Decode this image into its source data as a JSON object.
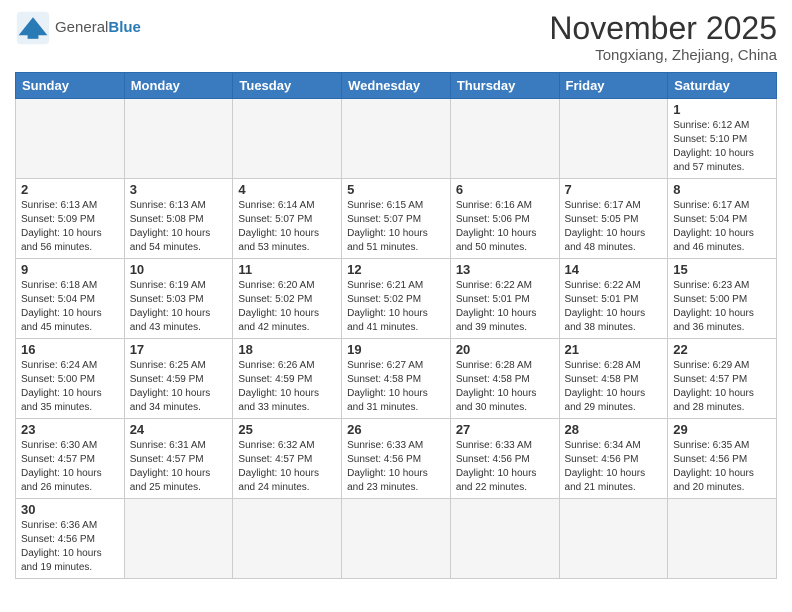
{
  "header": {
    "logo_general": "General",
    "logo_blue": "Blue",
    "month_title": "November 2025",
    "subtitle": "Tongxiang, Zhejiang, China"
  },
  "weekdays": [
    "Sunday",
    "Monday",
    "Tuesday",
    "Wednesday",
    "Thursday",
    "Friday",
    "Saturday"
  ],
  "weeks": [
    [
      {
        "day": "",
        "empty": true
      },
      {
        "day": "",
        "empty": true
      },
      {
        "day": "",
        "empty": true
      },
      {
        "day": "",
        "empty": true
      },
      {
        "day": "",
        "empty": true
      },
      {
        "day": "",
        "empty": true
      },
      {
        "day": "1",
        "sunrise": "Sunrise: 6:12 AM",
        "sunset": "Sunset: 5:10 PM",
        "daylight": "Daylight: 10 hours and 57 minutes."
      }
    ],
    [
      {
        "day": "2",
        "sunrise": "Sunrise: 6:13 AM",
        "sunset": "Sunset: 5:09 PM",
        "daylight": "Daylight: 10 hours and 56 minutes."
      },
      {
        "day": "3",
        "sunrise": "Sunrise: 6:13 AM",
        "sunset": "Sunset: 5:08 PM",
        "daylight": "Daylight: 10 hours and 54 minutes."
      },
      {
        "day": "4",
        "sunrise": "Sunrise: 6:14 AM",
        "sunset": "Sunset: 5:07 PM",
        "daylight": "Daylight: 10 hours and 53 minutes."
      },
      {
        "day": "5",
        "sunrise": "Sunrise: 6:15 AM",
        "sunset": "Sunset: 5:07 PM",
        "daylight": "Daylight: 10 hours and 51 minutes."
      },
      {
        "day": "6",
        "sunrise": "Sunrise: 6:16 AM",
        "sunset": "Sunset: 5:06 PM",
        "daylight": "Daylight: 10 hours and 50 minutes."
      },
      {
        "day": "7",
        "sunrise": "Sunrise: 6:17 AM",
        "sunset": "Sunset: 5:05 PM",
        "daylight": "Daylight: 10 hours and 48 minutes."
      },
      {
        "day": "8",
        "sunrise": "Sunrise: 6:17 AM",
        "sunset": "Sunset: 5:04 PM",
        "daylight": "Daylight: 10 hours and 46 minutes."
      }
    ],
    [
      {
        "day": "9",
        "sunrise": "Sunrise: 6:18 AM",
        "sunset": "Sunset: 5:04 PM",
        "daylight": "Daylight: 10 hours and 45 minutes."
      },
      {
        "day": "10",
        "sunrise": "Sunrise: 6:19 AM",
        "sunset": "Sunset: 5:03 PM",
        "daylight": "Daylight: 10 hours and 43 minutes."
      },
      {
        "day": "11",
        "sunrise": "Sunrise: 6:20 AM",
        "sunset": "Sunset: 5:02 PM",
        "daylight": "Daylight: 10 hours and 42 minutes."
      },
      {
        "day": "12",
        "sunrise": "Sunrise: 6:21 AM",
        "sunset": "Sunset: 5:02 PM",
        "daylight": "Daylight: 10 hours and 41 minutes."
      },
      {
        "day": "13",
        "sunrise": "Sunrise: 6:22 AM",
        "sunset": "Sunset: 5:01 PM",
        "daylight": "Daylight: 10 hours and 39 minutes."
      },
      {
        "day": "14",
        "sunrise": "Sunrise: 6:22 AM",
        "sunset": "Sunset: 5:01 PM",
        "daylight": "Daylight: 10 hours and 38 minutes."
      },
      {
        "day": "15",
        "sunrise": "Sunrise: 6:23 AM",
        "sunset": "Sunset: 5:00 PM",
        "daylight": "Daylight: 10 hours and 36 minutes."
      }
    ],
    [
      {
        "day": "16",
        "sunrise": "Sunrise: 6:24 AM",
        "sunset": "Sunset: 5:00 PM",
        "daylight": "Daylight: 10 hours and 35 minutes."
      },
      {
        "day": "17",
        "sunrise": "Sunrise: 6:25 AM",
        "sunset": "Sunset: 4:59 PM",
        "daylight": "Daylight: 10 hours and 34 minutes."
      },
      {
        "day": "18",
        "sunrise": "Sunrise: 6:26 AM",
        "sunset": "Sunset: 4:59 PM",
        "daylight": "Daylight: 10 hours and 33 minutes."
      },
      {
        "day": "19",
        "sunrise": "Sunrise: 6:27 AM",
        "sunset": "Sunset: 4:58 PM",
        "daylight": "Daylight: 10 hours and 31 minutes."
      },
      {
        "day": "20",
        "sunrise": "Sunrise: 6:28 AM",
        "sunset": "Sunset: 4:58 PM",
        "daylight": "Daylight: 10 hours and 30 minutes."
      },
      {
        "day": "21",
        "sunrise": "Sunrise: 6:28 AM",
        "sunset": "Sunset: 4:58 PM",
        "daylight": "Daylight: 10 hours and 29 minutes."
      },
      {
        "day": "22",
        "sunrise": "Sunrise: 6:29 AM",
        "sunset": "Sunset: 4:57 PM",
        "daylight": "Daylight: 10 hours and 28 minutes."
      }
    ],
    [
      {
        "day": "23",
        "sunrise": "Sunrise: 6:30 AM",
        "sunset": "Sunset: 4:57 PM",
        "daylight": "Daylight: 10 hours and 26 minutes."
      },
      {
        "day": "24",
        "sunrise": "Sunrise: 6:31 AM",
        "sunset": "Sunset: 4:57 PM",
        "daylight": "Daylight: 10 hours and 25 minutes."
      },
      {
        "day": "25",
        "sunrise": "Sunrise: 6:32 AM",
        "sunset": "Sunset: 4:57 PM",
        "daylight": "Daylight: 10 hours and 24 minutes."
      },
      {
        "day": "26",
        "sunrise": "Sunrise: 6:33 AM",
        "sunset": "Sunset: 4:56 PM",
        "daylight": "Daylight: 10 hours and 23 minutes."
      },
      {
        "day": "27",
        "sunrise": "Sunrise: 6:33 AM",
        "sunset": "Sunset: 4:56 PM",
        "daylight": "Daylight: 10 hours and 22 minutes."
      },
      {
        "day": "28",
        "sunrise": "Sunrise: 6:34 AM",
        "sunset": "Sunset: 4:56 PM",
        "daylight": "Daylight: 10 hours and 21 minutes."
      },
      {
        "day": "29",
        "sunrise": "Sunrise: 6:35 AM",
        "sunset": "Sunset: 4:56 PM",
        "daylight": "Daylight: 10 hours and 20 minutes."
      }
    ],
    [
      {
        "day": "30",
        "sunrise": "Sunrise: 6:36 AM",
        "sunset": "Sunset: 4:56 PM",
        "daylight": "Daylight: 10 hours and 19 minutes."
      },
      {
        "day": "",
        "empty": true
      },
      {
        "day": "",
        "empty": true
      },
      {
        "day": "",
        "empty": true
      },
      {
        "day": "",
        "empty": true
      },
      {
        "day": "",
        "empty": true
      },
      {
        "day": "",
        "empty": true
      }
    ]
  ]
}
